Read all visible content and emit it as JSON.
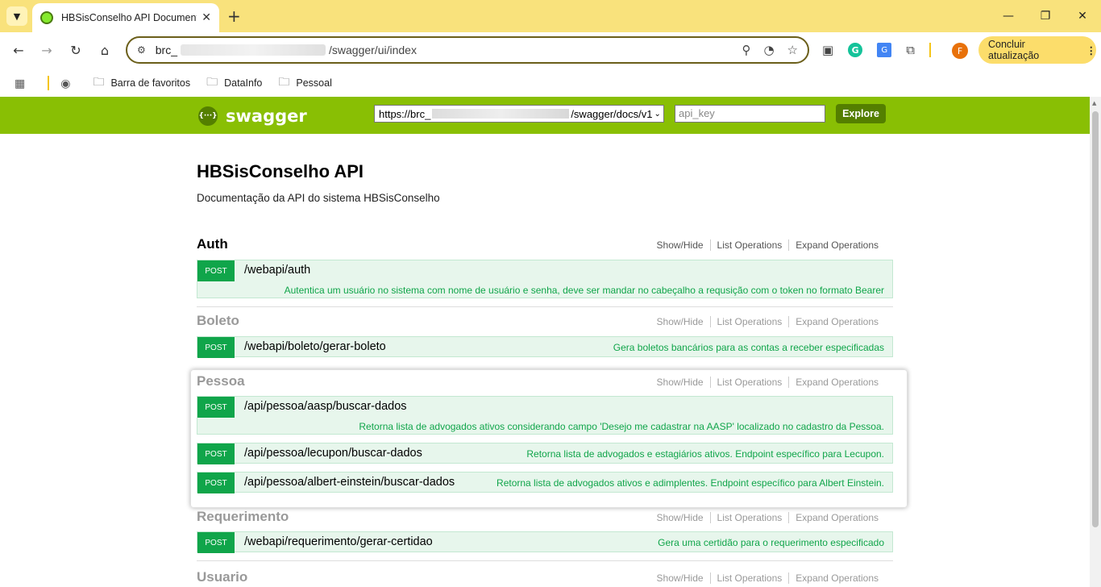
{
  "browser": {
    "tab_title": "HBSisConselho API Documentati",
    "url_prefix": "brc_",
    "url_suffix": "/swagger/ui/index",
    "update_button": "Concluir atualização",
    "avatar_letter": "F",
    "bookmarks": [
      {
        "label": "Barra de favoritos"
      },
      {
        "label": "DataInfo"
      },
      {
        "label": "Pessoal"
      }
    ]
  },
  "swagger": {
    "logo_text": "swagger",
    "url_prefix": "https://brc_",
    "url_suffix": "/swagger/docs/v1",
    "api_key_placeholder": "api_key",
    "explore_label": "Explore"
  },
  "info": {
    "title": "HBSisConselho API",
    "description": "Documentação da API do sistema HBSisConselho"
  },
  "links": {
    "show_hide": "Show/Hide",
    "list_ops": "List Operations",
    "expand_ops": "Expand Operations"
  },
  "resources": [
    {
      "name": "Auth",
      "operations": [
        {
          "verb": "POST",
          "path": "/webapi/auth",
          "desc": "Autentica um usuário no sistema com nome de usuário e senha, deve ser mandar no cabeçalho a requsição com o token no formato Bearer"
        }
      ]
    },
    {
      "name": "Boleto",
      "operations": [
        {
          "verb": "POST",
          "path": "/webapi/boleto/gerar-boleto",
          "desc": "Gera boletos bancários para as contas a receber especificadas"
        }
      ]
    },
    {
      "name": "Pessoa",
      "operations": [
        {
          "verb": "POST",
          "path": "/api/pessoa/aasp/buscar-dados",
          "desc": "Retorna lista de advogados ativos considerando campo 'Desejo me cadastrar na AASP' localizado no cadastro da Pessoa."
        },
        {
          "verb": "POST",
          "path": "/api/pessoa/lecupon/buscar-dados",
          "desc": "Retorna lista de advogados e estagiários ativos. Endpoint específico para Lecupon."
        },
        {
          "verb": "POST",
          "path": "/api/pessoa/albert-einstein/buscar-dados",
          "desc": "Retorna lista de advogados ativos e adimplentes. Endpoint específico para Albert Einstein."
        }
      ]
    },
    {
      "name": "Requerimento",
      "operations": [
        {
          "verb": "POST",
          "path": "/webapi/requerimento/gerar-certidao",
          "desc": "Gera uma certidão para o requerimento especificado"
        }
      ]
    },
    {
      "name": "Usuario",
      "operations": []
    }
  ],
  "colors": {
    "swagger_header": "#89bf04",
    "post_verb": "#10a54a",
    "op_bg": "#e7f6ec",
    "tabbar": "#f9e27c"
  }
}
